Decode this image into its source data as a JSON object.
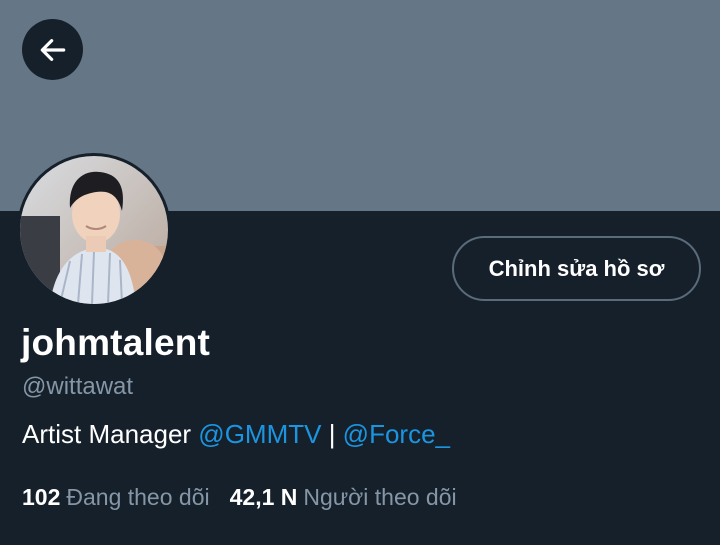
{
  "profile": {
    "display_name": "johmtalent",
    "handle": "@wittawat",
    "edit_button_label": "Chỉnh sửa hồ sơ",
    "bio": {
      "text": "Artist Manager ",
      "mention_1": "@GMMTV",
      "separator": " | ",
      "mention_2": "@Force_"
    },
    "stats": {
      "following_count": "102",
      "following_label": "Đang theo dõi",
      "followers_count": "42,1 N",
      "followers_label": "Người theo dõi"
    }
  },
  "icons": {
    "back": "arrow-left-icon",
    "avatar": "avatar-photo"
  },
  "colors": {
    "banner": "#657787",
    "background": "#16202b",
    "link": "#1b95e0",
    "secondary_text": "#8596a6",
    "button_border": "#5a6b7a"
  }
}
